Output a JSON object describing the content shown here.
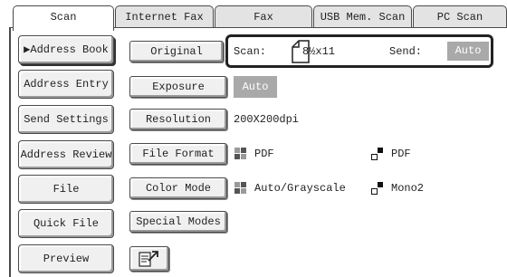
{
  "tabs": [
    "Scan",
    "Internet Fax",
    "Fax",
    "USB Mem. Scan",
    "PC Scan"
  ],
  "sidebar": {
    "items": [
      {
        "label": "Address Book",
        "marker": "▶"
      },
      {
        "label": "Address Entry"
      },
      {
        "label": "Send Settings"
      },
      {
        "label": "Address Review"
      },
      {
        "label": "File"
      },
      {
        "label": "Quick File"
      },
      {
        "label": "Preview"
      }
    ]
  },
  "settings": {
    "original_label": "Original",
    "scan_label": "Scan:",
    "scan_value": "8½x11",
    "send_label": "Send:",
    "send_value": "Auto",
    "exposure_label": "Exposure",
    "exposure_value": "Auto",
    "resolution_label": "Resolution",
    "resolution_value": "200X200dpi",
    "file_format_label": "File Format",
    "file_format_color": "PDF",
    "file_format_mono": "PDF",
    "color_mode_label": "Color Mode",
    "color_mode_color": "Auto/Grayscale",
    "color_mode_mono": "Mono2",
    "special_modes_label": "Special Modes"
  },
  "icons": {
    "color_icon": "four-square-color-icon",
    "mono_icon": "black-white-squares-icon",
    "document_icon": "document-page-icon",
    "program_icon": "program-arrow-icon"
  },
  "colors": {
    "grey_value_bg": "#a9a9a9",
    "border": "#4a4a4a"
  }
}
